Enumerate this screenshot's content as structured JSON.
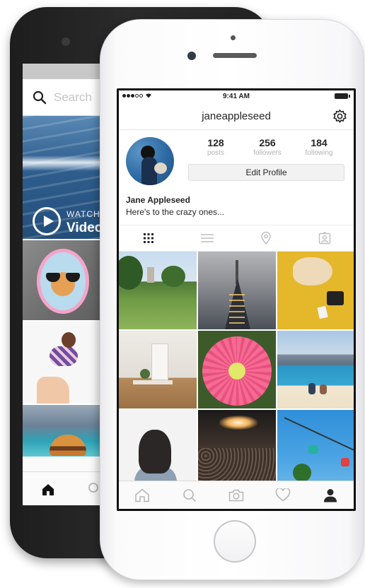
{
  "back_phone": {
    "search_placeholder": "Search",
    "watch_label": "WATCH",
    "video_label": "Video",
    "icons": [
      "search-icon",
      "play-icon",
      "home-icon"
    ]
  },
  "front_phone": {
    "status": {
      "time": "9:41 AM"
    },
    "header": {
      "username": "janeappleseed",
      "settings_icon": "gear-icon"
    },
    "profile": {
      "stats": [
        {
          "value": "128",
          "label": "posts"
        },
        {
          "value": "256",
          "label": "followers"
        },
        {
          "value": "184",
          "label": "following"
        }
      ],
      "edit_label": "Edit Profile",
      "full_name": "Jane Appleseed",
      "bio": "Here's to the crazy ones..."
    },
    "view_tabs": [
      "grid-icon",
      "list-icon",
      "location-pin-icon",
      "tagged-photos-icon"
    ],
    "tab_bar": [
      "home-icon",
      "search-icon",
      "camera-icon",
      "heart-icon",
      "profile-icon"
    ]
  },
  "colors": {
    "text": "#262626",
    "muted": "#b3b3b3",
    "active_icon": "#262626",
    "inactive_icon": "#b5b5b5"
  }
}
